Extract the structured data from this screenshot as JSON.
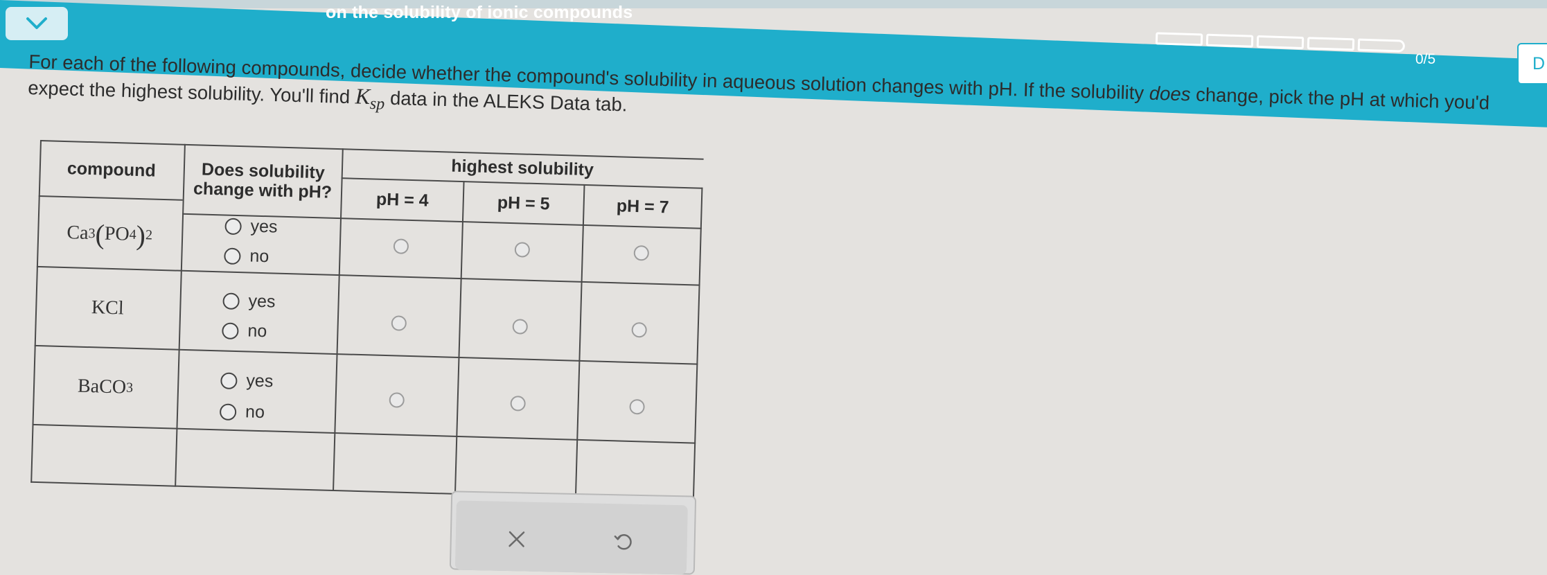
{
  "header": {
    "topic_title": "on the solubility of ionic compounds",
    "progress": {
      "completed": 0,
      "total": 5,
      "label": "0/5"
    },
    "user_initial": "D",
    "accent_color": "#1faecb"
  },
  "instructions": {
    "part1": "For each of the following compounds, decide whether the compound's solubility in aqueous solution changes with pH. If the solubility ",
    "emphasis": "does",
    "part2": " change, pick the pH at which you'd expect the highest solubility. You'll find ",
    "ksp_main": "K",
    "ksp_sub": "sp",
    "part3": " data in the ALEKS Data tab."
  },
  "table": {
    "headers": {
      "compound": "compound",
      "changes": "Does solubility change with pH?",
      "highest": "highest solubility",
      "ph_columns": [
        "pH = 4",
        "pH = 5",
        "pH = 7"
      ]
    },
    "rows": [
      {
        "formula_html": "Ca<sub>3</sub><span class=\"paren\">(</span>PO<sub>4</sub><span class=\"paren\">)</span><sub>2</sub>",
        "yes_label": "yes",
        "no_label": "no"
      },
      {
        "formula_html": "KCl",
        "yes_label": "yes",
        "no_label": "no"
      },
      {
        "formula_html": "BaCO<sub>3</sub>",
        "yes_label": "yes",
        "no_label": "no"
      }
    ]
  },
  "actions": {
    "clear_icon": "x-icon",
    "undo_icon": "undo-icon"
  }
}
